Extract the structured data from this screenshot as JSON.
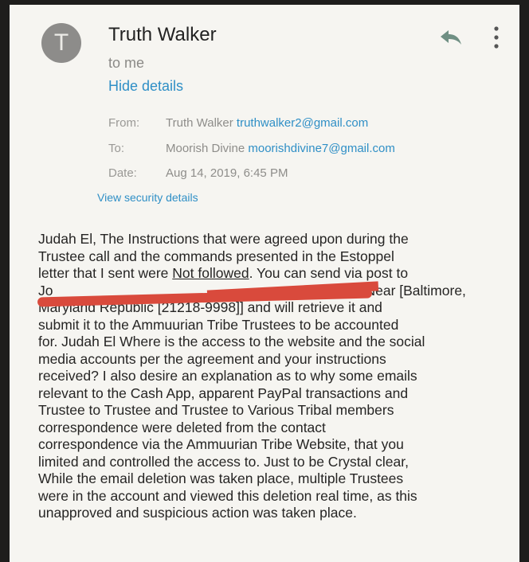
{
  "header": {
    "avatar_letter": "T",
    "sender_name": "Truth Walker",
    "recipient_summary": "to me",
    "hide_details_label": "Hide details"
  },
  "icons": {
    "reply": "reply-icon",
    "more": "more-vert-icon"
  },
  "details": {
    "from": {
      "label": "From:",
      "name": "Truth Walker",
      "email": "truthwalker2@gmail.com"
    },
    "to": {
      "label": "To:",
      "name": "Moorish Divine",
      "email": "moorishdivine7@gmail.com"
    },
    "date": {
      "label": "Date:",
      "value": "Aug 14, 2019, 6:45 PM"
    },
    "view_security_label": "View security details"
  },
  "body": {
    "line1": "Judah El, The Instructions that were agreed upon during the",
    "line2": "Trustee call and the commands presented in the Estoppel",
    "line3_pre": "letter that I sent were ",
    "line3_underlined": "Not followed",
    "line3_post": ". You can send via post to",
    "line4_start": "Jo",
    "line4_end": "Near [Baltimore,",
    "line5": "Maryland Republic [21218-9998]] and will retrieve it and",
    "line6": "submit it to the Ammuurian Tribe Trustees to be accounted",
    "line7": "for. Judah El Where is the access to the website and the social",
    "line8": "media accounts per the agreement and your instructions",
    "line9": "received? I also desire an explanation as to why some emails",
    "line10": "relevant to the Cash App, apparent PayPal transactions and",
    "line11": "Trustee to Trustee and Trustee to Various Tribal members",
    "line12": "correspondence were deleted from the contact",
    "line13": "correspondence via the Ammuurian Tribe Website, that you",
    "line14": "limited and controlled the access to. Just to be Crystal clear,",
    "line15": "While the email deletion was taken place, multiple Trustees",
    "line16": "were in the account and viewed this deletion real time, as this",
    "line17": "unapproved and suspicious action was taken place."
  },
  "colors": {
    "link": "#2f8fc6",
    "redaction": "#d94a3c",
    "reply_icon": "#6f8f83"
  }
}
